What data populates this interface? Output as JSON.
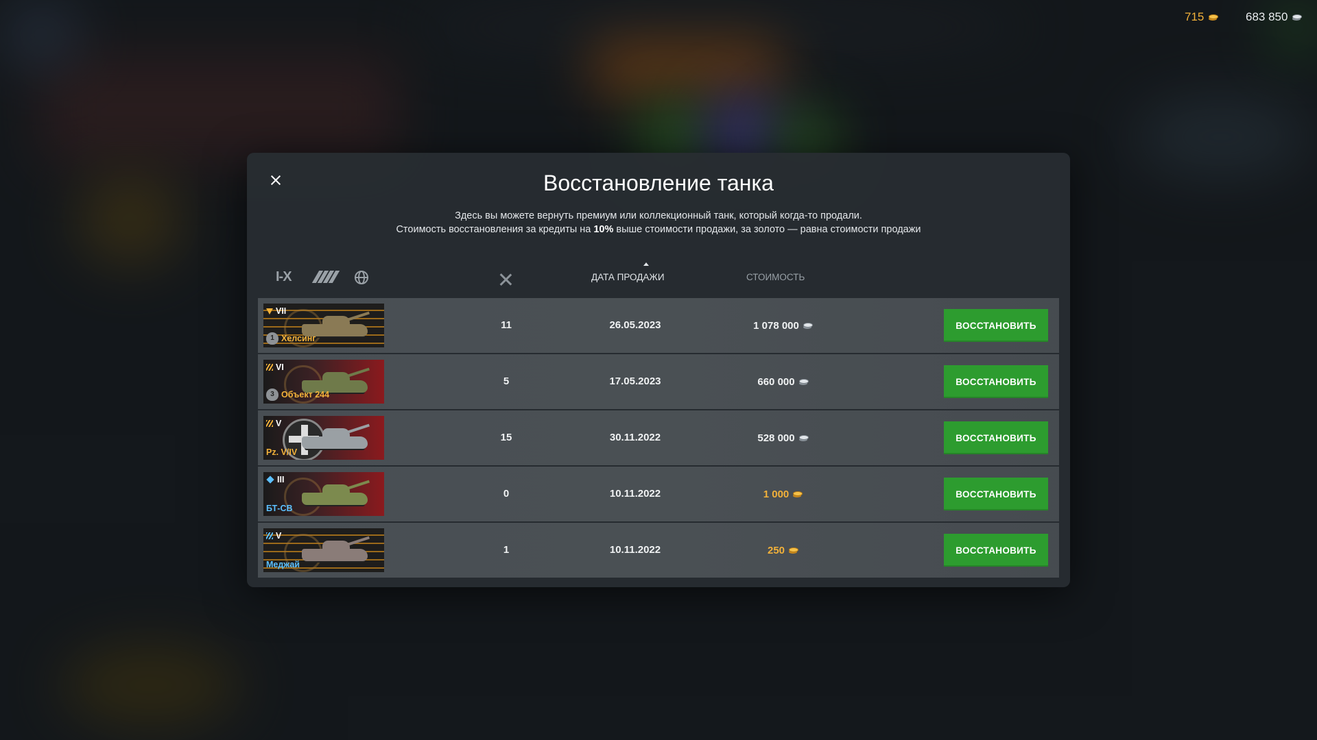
{
  "currency": {
    "gold": "715",
    "credits": "683 850"
  },
  "modal": {
    "title": "Восстановление танка",
    "description_line1": "Здесь вы можете вернуть премиум или коллекционный танк, который когда-то продали.",
    "description_line2_pre": "Стоимость восстановления за кредиты на ",
    "description_line2_bold": "10%",
    "description_line2_post": " выше стоимости продажи, за золото — равна стоимости продажи"
  },
  "header": {
    "filter_tier_label": "I-X",
    "column_date": "ДАТА ПРОДАЖИ",
    "column_cost": "СТОИМОСТЬ",
    "sort_column": "date",
    "icons": [
      "tier-filter-icon",
      "type-filter-icon",
      "nation-filter-icon",
      "battles-icon",
      "sort-asc-icon"
    ]
  },
  "restore_label": "ВОССТАНОВИТЬ",
  "rows": [
    {
      "tier": "VII",
      "class_icon": "premium-marker-icon",
      "name": "Хелсинг",
      "name_color": "#f2b13a",
      "mastery": "1",
      "battles": "11",
      "date": "26.05.2023",
      "price": "1 078 000",
      "currency": "credits"
    },
    {
      "tier": "VI",
      "class_icon": "premium-class-icon",
      "name": "Объект 244",
      "name_color": "#f2b13a",
      "mastery": "3",
      "battles": "5",
      "date": "17.05.2023",
      "price": "660 000",
      "currency": "credits"
    },
    {
      "tier": "V",
      "class_icon": "premium-class-icon",
      "name": "Pz. V/IV",
      "name_color": "#f2b13a",
      "mastery": "",
      "battles": "15",
      "date": "30.11.2022",
      "price": "528 000",
      "currency": "credits"
    },
    {
      "tier": "III",
      "class_icon": "collector-class-icon",
      "name": "БТ-СВ",
      "name_color": "#5cc0ff",
      "mastery": "",
      "battles": "0",
      "date": "10.11.2022",
      "price": "1 000",
      "currency": "gold"
    },
    {
      "tier": "V",
      "class_icon": "collector-class-icon",
      "name": "Меджай",
      "name_color": "#5cc0ff",
      "mastery": "",
      "battles": "1",
      "date": "10.11.2022",
      "price": "250",
      "currency": "gold"
    }
  ]
}
